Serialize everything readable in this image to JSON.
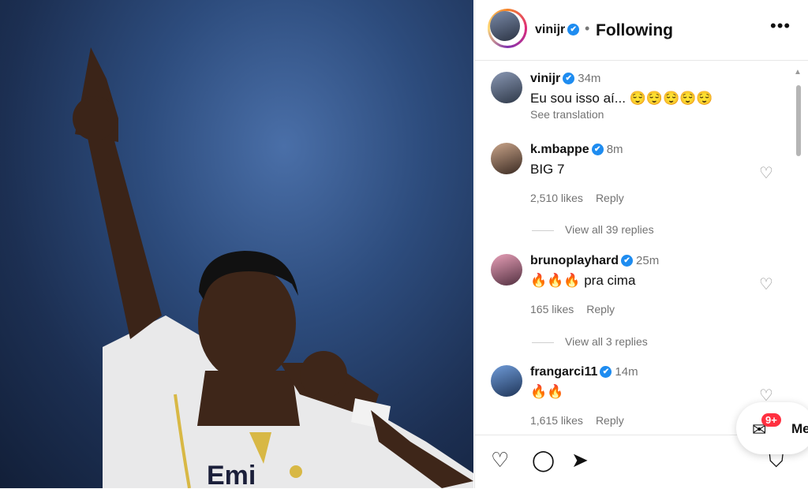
{
  "post": {
    "header": {
      "username": "vinijr",
      "verified_mark": "✔",
      "separator": "•",
      "follow_state": "Following",
      "more_icon": "•••"
    },
    "photo": {
      "shirt_text": "Emi"
    },
    "comments": [
      {
        "username": "vinijr",
        "time": "34m",
        "text": "Eu sou isso aí... 😌😌😌😌😌",
        "sub": "See translation"
      },
      {
        "username": "k.mbappe",
        "time": "8m",
        "text": "BIG 7",
        "likes": "2,510 likes",
        "reply": "Reply",
        "view_all": "View all 39 replies"
      },
      {
        "username": "brunoplayhard",
        "time": "25m",
        "text": "🔥🔥🔥 pra cima",
        "likes": "165 likes",
        "reply": "Reply",
        "view_all": "View all 3 replies"
      },
      {
        "username": "frangarci11",
        "time": "14m",
        "text": "🔥🔥",
        "likes": "1,615 likes",
        "reply": "Reply"
      }
    ],
    "icons": {
      "heart": "♡",
      "comment": "◯",
      "share": "➤",
      "save": "⛉",
      "scroll_up": "▲"
    }
  },
  "messages": {
    "badge": "9+",
    "label": "Me"
  }
}
